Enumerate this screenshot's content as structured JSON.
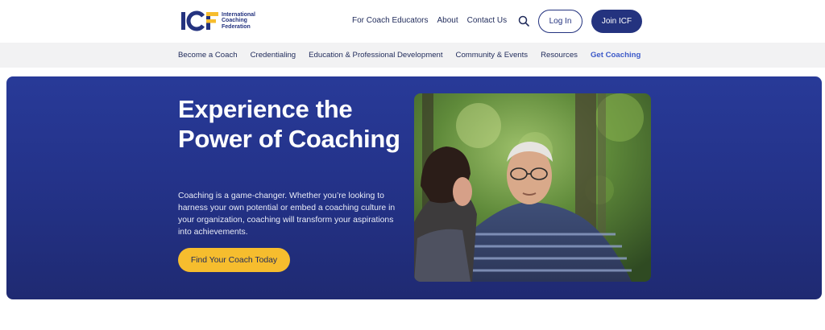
{
  "brand": {
    "logo_letters": "ICF",
    "name_lines": [
      "International",
      "Coaching",
      "Federation"
    ]
  },
  "utility_nav": {
    "links": [
      "For Coach Educators",
      "About",
      "Contact Us"
    ],
    "search_icon": "search-icon",
    "login_label": "Log In",
    "join_label": "Join ICF"
  },
  "main_nav": {
    "items": [
      {
        "label": "Become a Coach",
        "active": false
      },
      {
        "label": "Credentialing",
        "active": false
      },
      {
        "label": "Education & Professional Development",
        "active": false
      },
      {
        "label": "Community & Events",
        "active": false
      },
      {
        "label": "Resources",
        "active": false
      },
      {
        "label": "Get Coaching",
        "active": true
      }
    ]
  },
  "hero": {
    "title": "Experience the Power of Coaching",
    "description": "Coaching is a game-changer. Whether you’re looking to harness your own potential or embed a coaching culture in your organization, coaching will transform your aspirations into achievements.",
    "cta_label": "Find Your Coach Today"
  },
  "colors": {
    "brand_navy": "#24337f",
    "accent_yellow": "#f6bd2e",
    "active_link": "#3d5ac9",
    "nav_band": "#f2f2f3"
  }
}
